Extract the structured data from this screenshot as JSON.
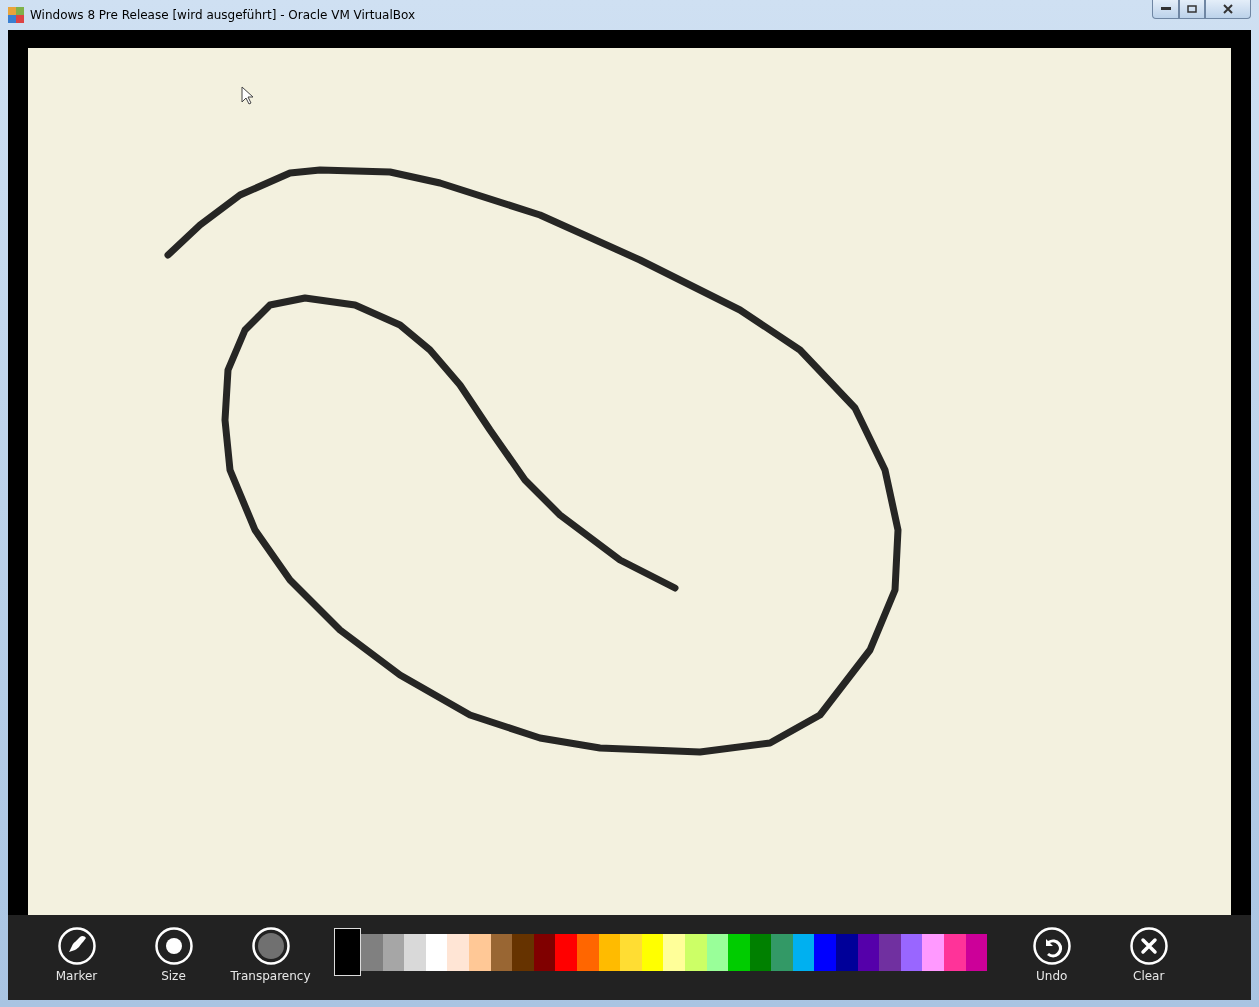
{
  "window": {
    "title": "Windows 8 Pre Release [wird ausgeführt] - Oracle VM VirtualBox"
  },
  "tools": [
    {
      "label": "Marker",
      "kind": "marker"
    },
    {
      "label": "Size",
      "kind": "size"
    },
    {
      "label": "Transparency",
      "kind": "transparency"
    }
  ],
  "palette": [
    {
      "color": "#000000",
      "selected": true
    },
    {
      "color": "#808080",
      "selected": false
    },
    {
      "color": "#a6a6a6",
      "selected": false
    },
    {
      "color": "#d9d9d9",
      "selected": false
    },
    {
      "color": "#ffffff",
      "selected": false
    },
    {
      "color": "#ffe5d5",
      "selected": false
    },
    {
      "color": "#ffc896",
      "selected": false
    },
    {
      "color": "#996633",
      "selected": false
    },
    {
      "color": "#663300",
      "selected": false
    },
    {
      "color": "#800000",
      "selected": false
    },
    {
      "color": "#ff0000",
      "selected": false
    },
    {
      "color": "#ff6600",
      "selected": false
    },
    {
      "color": "#ffbb00",
      "selected": false
    },
    {
      "color": "#ffdd33",
      "selected": false
    },
    {
      "color": "#ffff00",
      "selected": false
    },
    {
      "color": "#ffff99",
      "selected": false
    },
    {
      "color": "#ccff66",
      "selected": false
    },
    {
      "color": "#99ff99",
      "selected": false
    },
    {
      "color": "#00cc00",
      "selected": false
    },
    {
      "color": "#008000",
      "selected": false
    },
    {
      "color": "#339966",
      "selected": false
    },
    {
      "color": "#00b0f0",
      "selected": false
    },
    {
      "color": "#0000ff",
      "selected": false
    },
    {
      "color": "#000099",
      "selected": false
    },
    {
      "color": "#5500aa",
      "selected": false
    },
    {
      "color": "#7030a0",
      "selected": false
    },
    {
      "color": "#9966ff",
      "selected": false
    },
    {
      "color": "#ff99ff",
      "selected": false
    },
    {
      "color": "#ff3399",
      "selected": false
    },
    {
      "color": "#cc0099",
      "selected": false
    }
  ],
  "actions": [
    {
      "label": "Undo",
      "kind": "undo"
    },
    {
      "label": "Clear",
      "kind": "clear"
    }
  ]
}
